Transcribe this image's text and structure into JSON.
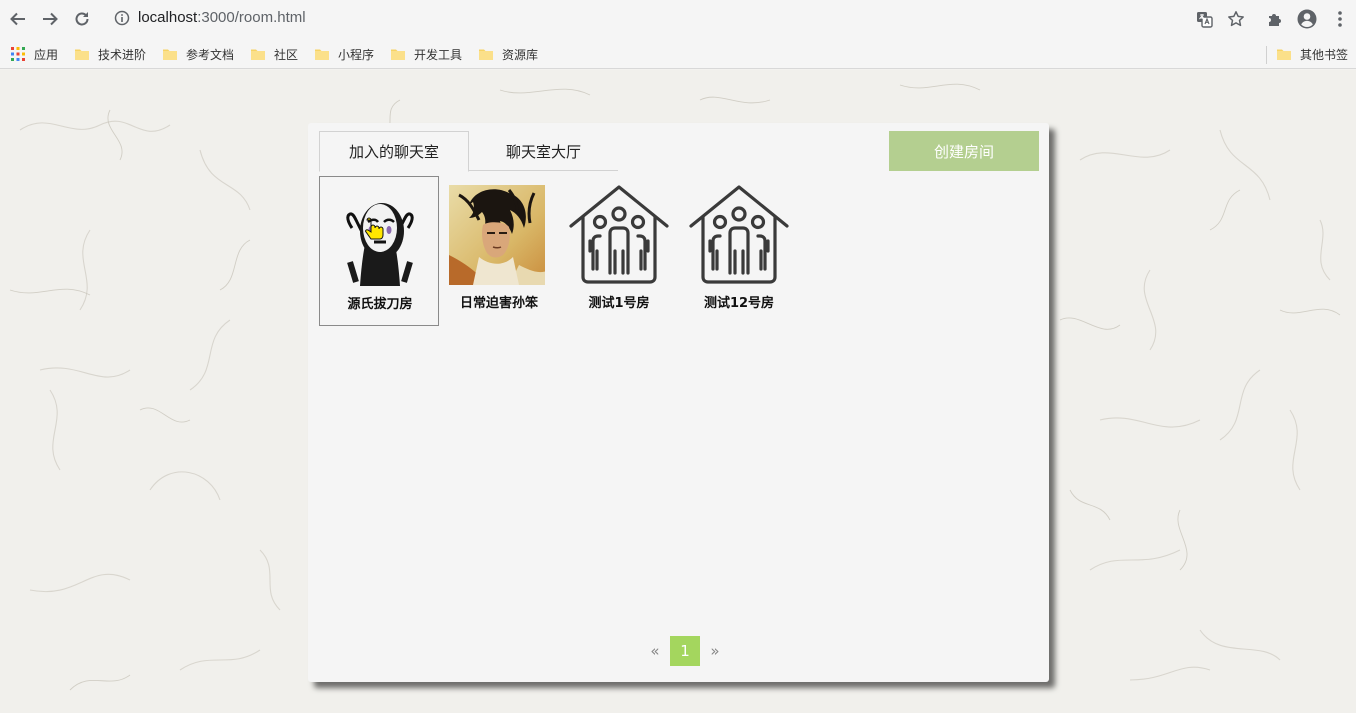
{
  "browser": {
    "url_host": "localhost",
    "url_rest": ":3000/room.html",
    "bookmarks": [
      {
        "label": "应用",
        "icon": "apps-grid-icon"
      },
      {
        "label": "技术进阶",
        "icon": "folder-icon"
      },
      {
        "label": "参考文档",
        "icon": "folder-icon"
      },
      {
        "label": "社区",
        "icon": "folder-icon"
      },
      {
        "label": "小程序",
        "icon": "folder-icon"
      },
      {
        "label": "开发工具",
        "icon": "folder-icon"
      },
      {
        "label": "资源库",
        "icon": "folder-icon"
      }
    ],
    "other_bookmarks": "其他书签"
  },
  "tabs": [
    {
      "label": "加入的聊天室",
      "active": true
    },
    {
      "label": "聊天室大厅",
      "active": false
    }
  ],
  "create_button": "创建房间",
  "rooms": [
    {
      "name": "源氏拔刀房",
      "avatar": "no-face-avatar",
      "selected": true
    },
    {
      "name": "日常迫害孙笨",
      "avatar": "warrior-avatar",
      "selected": false
    },
    {
      "name": "测试1号房",
      "avatar": "house-group-icon",
      "selected": false
    },
    {
      "name": "测试12号房",
      "avatar": "house-group-icon",
      "selected": false
    }
  ],
  "pagination": {
    "prev": "«",
    "current": "1",
    "next": "»"
  },
  "colors": {
    "create_button_bg": "#b4cf90",
    "page_active_bg": "#a4d65e",
    "panel_bg": "#f5f5f5"
  }
}
